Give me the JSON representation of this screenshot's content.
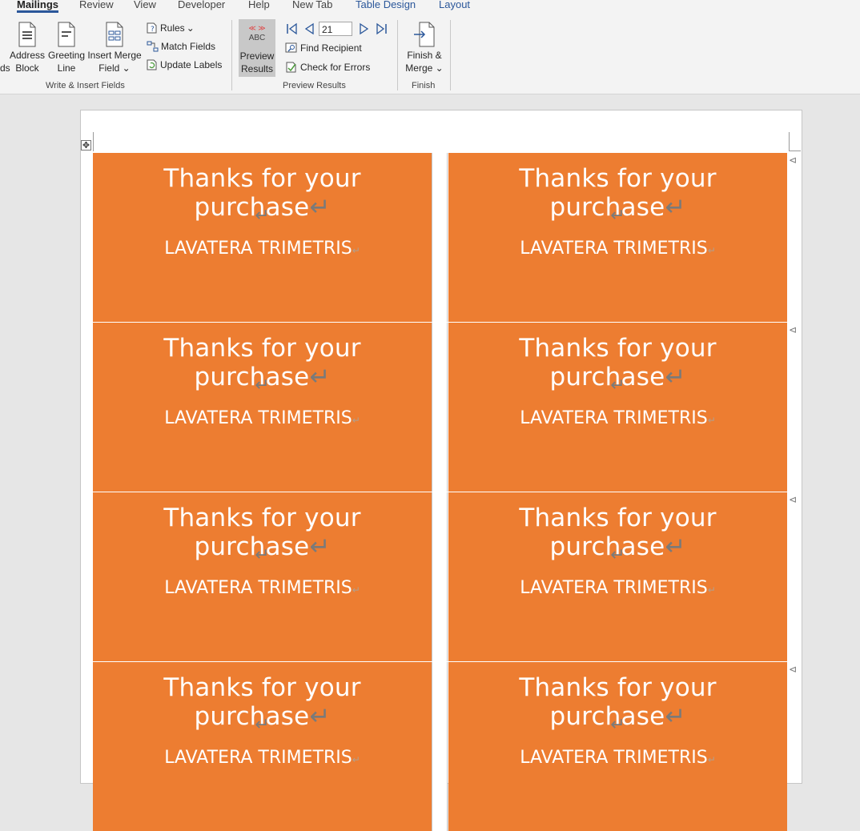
{
  "tabs": [
    "Mailings",
    "Review",
    "View",
    "Developer",
    "Help",
    "New Tab",
    "Table Design",
    "Layout"
  ],
  "ribbon": {
    "write_insert": {
      "address_block": [
        "Address",
        "Block"
      ],
      "greeting_line": [
        "Greeting",
        "Line"
      ],
      "insert_merge_field": [
        "Insert Merge",
        "Field"
      ],
      "rules": "Rules",
      "match_fields": "Match Fields",
      "update_labels": "Update Labels",
      "group_label": "Write & Insert Fields",
      "cut_label": "ds"
    },
    "preview": {
      "preview_results": [
        "Preview",
        "Results"
      ],
      "abc_glyph": "ABC",
      "record_number": "21",
      "find_recipient": "Find Recipient",
      "check_errors": "Check for Errors",
      "group_label": "Preview Results"
    },
    "finish": {
      "finish_merge": [
        "Finish &",
        "Merge"
      ],
      "group_label": "Finish"
    }
  },
  "document": {
    "labels": [
      {
        "title": "Thanks for your purchase",
        "name": "LAVATERA TRIMETRIS"
      },
      {
        "title": "Thanks for your purchase",
        "name": "LAVATERA TRIMETRIS"
      },
      {
        "title": "Thanks for your purchase",
        "name": "LAVATERA TRIMETRIS"
      },
      {
        "title": "Thanks for your purchase",
        "name": "LAVATERA TRIMETRIS"
      },
      {
        "title": "Thanks for your purchase",
        "name": "LAVATERA TRIMETRIS"
      },
      {
        "title": "Thanks for your purchase",
        "name": "LAVATERA TRIMETRIS"
      },
      {
        "title": "Thanks for your purchase",
        "name": "LAVATERA TRIMETRIS"
      },
      {
        "title": "Thanks for your purchase",
        "name": "LAVATERA TRIMETRIS"
      }
    ],
    "label_color": "#ED7D31",
    "paragraph_mark": "↵",
    "end_of_cell_mark": "⊲"
  },
  "colors": {
    "ribbon_bg": "#F3F3F3",
    "accent": "#2B579A",
    "page_bg": "#E6E6E6"
  }
}
